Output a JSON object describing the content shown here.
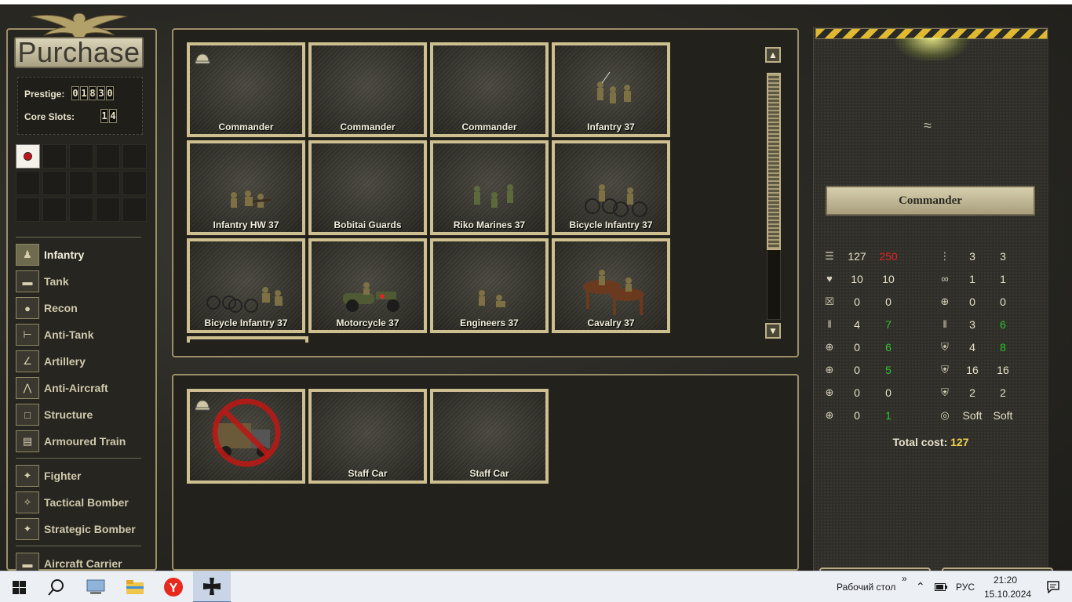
{
  "game": {
    "title": "Purchase",
    "prestige_label": "Prestige:",
    "prestige_digits": [
      "0",
      "1",
      "8",
      "3",
      "0"
    ],
    "core_slots_label": "Core Slots:",
    "core_slots_digits": [
      "1",
      "4"
    ],
    "categories": [
      {
        "label": "Infantry",
        "icon": "infantry-icon",
        "active": true
      },
      {
        "label": "Tank",
        "icon": "tank-icon"
      },
      {
        "label": "Recon",
        "icon": "recon-icon"
      },
      {
        "label": "Anti-Tank",
        "icon": "anti-tank-icon"
      },
      {
        "label": "Artillery",
        "icon": "artillery-icon"
      },
      {
        "label": "Anti-Aircraft",
        "icon": "anti-aircraft-icon"
      },
      {
        "label": "Structure",
        "icon": "structure-icon"
      },
      {
        "label": "Armoured Train",
        "icon": "train-icon"
      },
      {
        "label": "Fighter",
        "icon": "fighter-icon"
      },
      {
        "label": "Tactical Bomber",
        "icon": "tactical-bomber-icon"
      },
      {
        "label": "Strategic Bomber",
        "icon": "strategic-bomber-icon"
      },
      {
        "label": "Aircraft Carrier",
        "icon": "aircraft-carrier-icon"
      }
    ],
    "units": [
      "Commander",
      "Commander",
      "Commander",
      "Infantry 37",
      "Infantry HW 37",
      "Bobitai Guards",
      "Riko Marines 37",
      "Bicycle Infantry 37",
      "Bicycle Infantry 37",
      "Motorcycle 37",
      "Engineers 37",
      "Cavalry 37"
    ],
    "transports": [
      "",
      "Staff Car",
      "Staff Car"
    ],
    "selected_unit": "Commander",
    "stats_left": [
      {
        "icon": "coins-icon",
        "v1": "127",
        "v2": "250",
        "v2_color": "red"
      },
      {
        "icon": "heart-icon",
        "v1": "10",
        "v2": "10"
      },
      {
        "icon": "ammo-box-icon",
        "v1": "0",
        "v2": "0"
      },
      {
        "icon": "bullets-icon",
        "v1": "4",
        "v2": "7",
        "v2_color": "green"
      },
      {
        "icon": "soft-attack-icon",
        "v1": "0",
        "v2": "6",
        "v2_color": "green"
      },
      {
        "icon": "hard-attack-icon",
        "v1": "0",
        "v2": "5",
        "v2_color": "green"
      },
      {
        "icon": "air-attack-icon",
        "v1": "0",
        "v2": "0"
      },
      {
        "icon": "naval-attack-icon",
        "v1": "0",
        "v2": "1",
        "v2_color": "green"
      }
    ],
    "stats_right": [
      {
        "icon": "footsteps-icon",
        "v1": "3",
        "v2": "3"
      },
      {
        "icon": "binoculars-icon",
        "v1": "1",
        "v2": "1"
      },
      {
        "icon": "crosshair-icon",
        "v1": "0",
        "v2": "0"
      },
      {
        "icon": "initiative-icon",
        "v1": "3",
        "v2": "6",
        "v2_color": "green"
      },
      {
        "icon": "ground-defense-icon",
        "v1": "4",
        "v2": "8",
        "v2_color": "green"
      },
      {
        "icon": "air-defense-icon",
        "v1": "16",
        "v2": "16"
      },
      {
        "icon": "close-defense-icon",
        "v1": "2",
        "v2": "2"
      },
      {
        "icon": "target-type-icon",
        "v1": "Soft",
        "v2": "Soft"
      }
    ],
    "total_cost_label": "Total cost:",
    "total_cost_value": "127",
    "colors": {
      "frame": "#cdbf8f",
      "green": "#2ec42e",
      "red": "#e22424",
      "gold": "#f2d050"
    }
  },
  "taskbar": {
    "apps": [
      "start-icon",
      "search-icon",
      "system-monitor-icon",
      "file-explorer-icon",
      "yandex-browser-icon",
      "game-icon"
    ],
    "desktop_label": "Рабочий стол",
    "chevron": "»",
    "language": "РУС",
    "time": "21:20",
    "date": "15.10.2024"
  }
}
